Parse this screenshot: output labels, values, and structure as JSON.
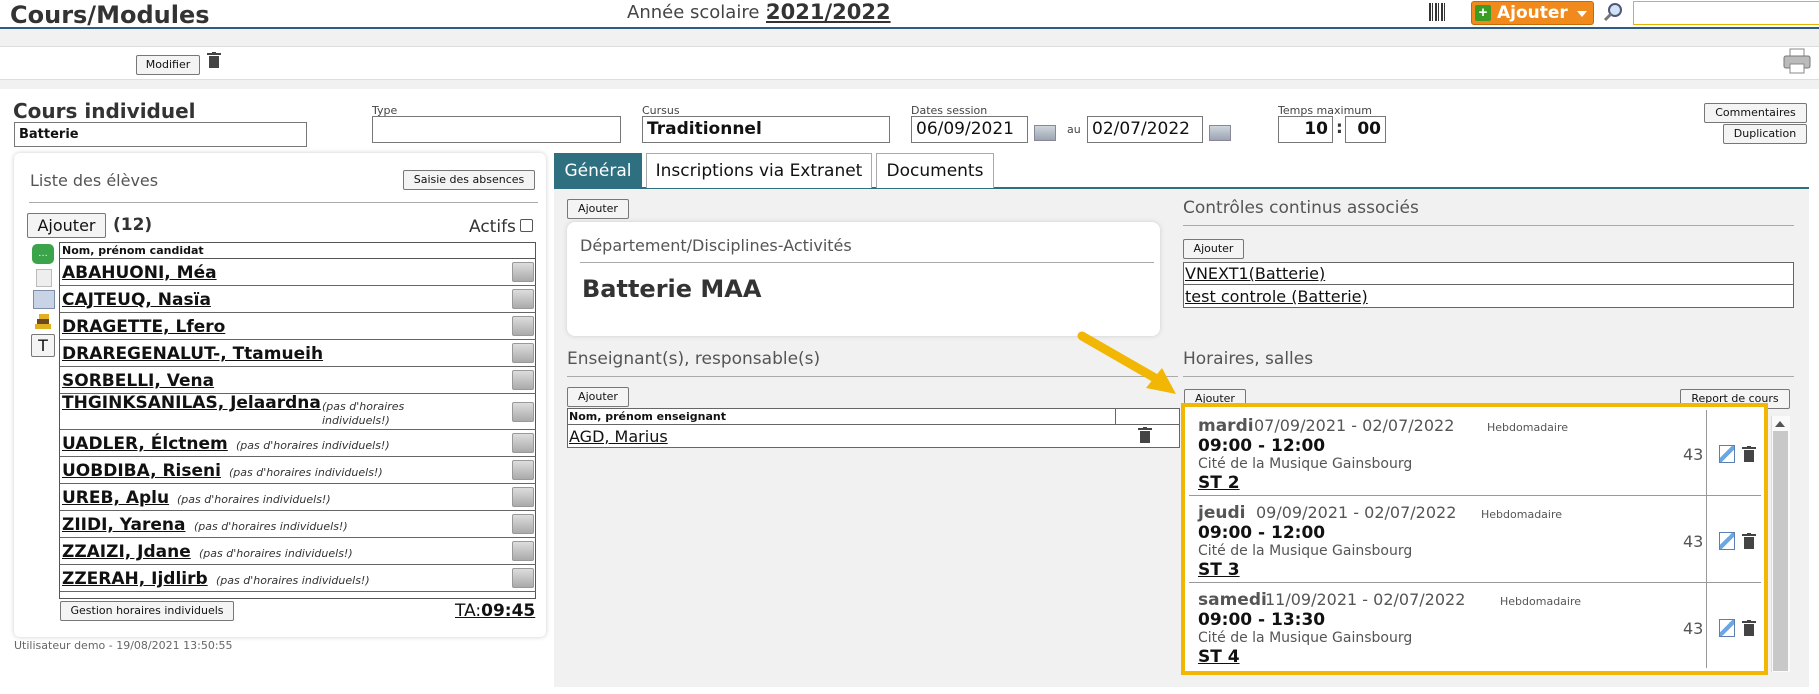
{
  "header": {
    "title": "Cours/Modules",
    "year_label": "Année scolaire :",
    "year_value": "2021/2022",
    "add_label": "Ajouter",
    "search_placeholder": ""
  },
  "toolbar": {
    "modify_label": "Modifier"
  },
  "course": {
    "heading": "Cours individuel",
    "name_value": "Batterie",
    "type_label": "Type",
    "type_value": "",
    "cursus_label": "Cursus",
    "cursus_value": "Traditionnel",
    "dates_label": "Dates session",
    "date_start": "06/09/2021",
    "au_label": "au",
    "date_end": "02/07/2022",
    "max_time_label": "Temps maximum",
    "max_hours": "10",
    "time_sep": ":",
    "max_minutes": "00",
    "comments_label": "Commentaires",
    "duplicate_label": "Duplication"
  },
  "students": {
    "title": "Liste des élèves",
    "absences_button": "Saisie des absences",
    "add_button": "Ajouter",
    "count": "(12)",
    "active_label": "Actifs",
    "column_header": "Nom, prénom candidat",
    "rows": [
      {
        "name": "ABAHUONI, Méa",
        "note": ""
      },
      {
        "name": "CAJTEUQ, Nasïa",
        "note": ""
      },
      {
        "name": "DRAGETTE, Lfero",
        "note": ""
      },
      {
        "name": "DRAREGENALUT-, Ttamueih",
        "note": ""
      },
      {
        "name": "SORBELLI, Vena",
        "note": ""
      },
      {
        "name": "THGINKSANILAS, Jelaardna",
        "note": "(pas d'horaires individuels!)"
      },
      {
        "name": "UADLER, Élctnem",
        "note": "(pas d'horaires individuels!)"
      },
      {
        "name": "UOBDIBA, Riseni",
        "note": "(pas d'horaires individuels!)"
      },
      {
        "name": "UREB, Aplu",
        "note": "(pas d'horaires individuels!)"
      },
      {
        "name": "ZIIDI, Yarena",
        "note": "(pas d'horaires individuels!)"
      },
      {
        "name": "ZZAIZI, Jdane",
        "note": "(pas d'horaires individuels!)"
      },
      {
        "name": "ZZERAH, Ijdlirb",
        "note": "(pas d'horaires individuels!)"
      }
    ],
    "side_letter": "T",
    "hours_button": "Gestion horaires individuels",
    "ta_label": "TA:",
    "ta_value": "09:45"
  },
  "footer_user": "Utilisateur demo - 19/08/2021 13:50:55",
  "tabs": [
    "Général",
    "Inscriptions via Extranet",
    "Documents"
  ],
  "general": {
    "add_button": "Ajouter",
    "dept_title": "Département/Disciplines-Activités",
    "dept_value": "Batterie MAA",
    "teachers_title": "Enseignant(s), responsable(s)",
    "teachers_add": "Ajouter",
    "teachers_header": "Nom, prénom enseignant",
    "teachers": [
      "AGD, Marius"
    ],
    "controls_title": "Contrôles continus associés",
    "controls_add": "Ajouter",
    "controls": [
      "VNEXT1(Batterie)",
      "test controle (Batterie)"
    ],
    "schedule_title": "Horaires, salles",
    "schedule_add": "Ajouter",
    "report_button": "Report de cours",
    "slots": [
      {
        "day": "mardi",
        "period": "07/09/2021 - 02/07/2022",
        "freq": "Hebdomadaire",
        "time": "09:00 - 12:00",
        "place": "Cité de la Musique Gainsbourg",
        "room": "ST 2",
        "count": "43"
      },
      {
        "day": "jeudi",
        "period": "09/09/2021 - 02/07/2022",
        "freq": "Hebdomadaire",
        "time": "09:00 - 12:00",
        "place": "Cité de la Musique Gainsbourg",
        "room": "ST 3",
        "count": "43"
      },
      {
        "day": "samedi",
        "period": "11/09/2021 - 02/07/2022",
        "freq": "Hebdomadaire",
        "time": "09:00 - 13:30",
        "place": "Cité de la Musique Gainsbourg",
        "room": "ST 4",
        "count": "43"
      }
    ]
  },
  "colors": {
    "accent_blue": "#2e6f80",
    "add_orange": "#f08a1c",
    "highlight": "#f2b705"
  }
}
